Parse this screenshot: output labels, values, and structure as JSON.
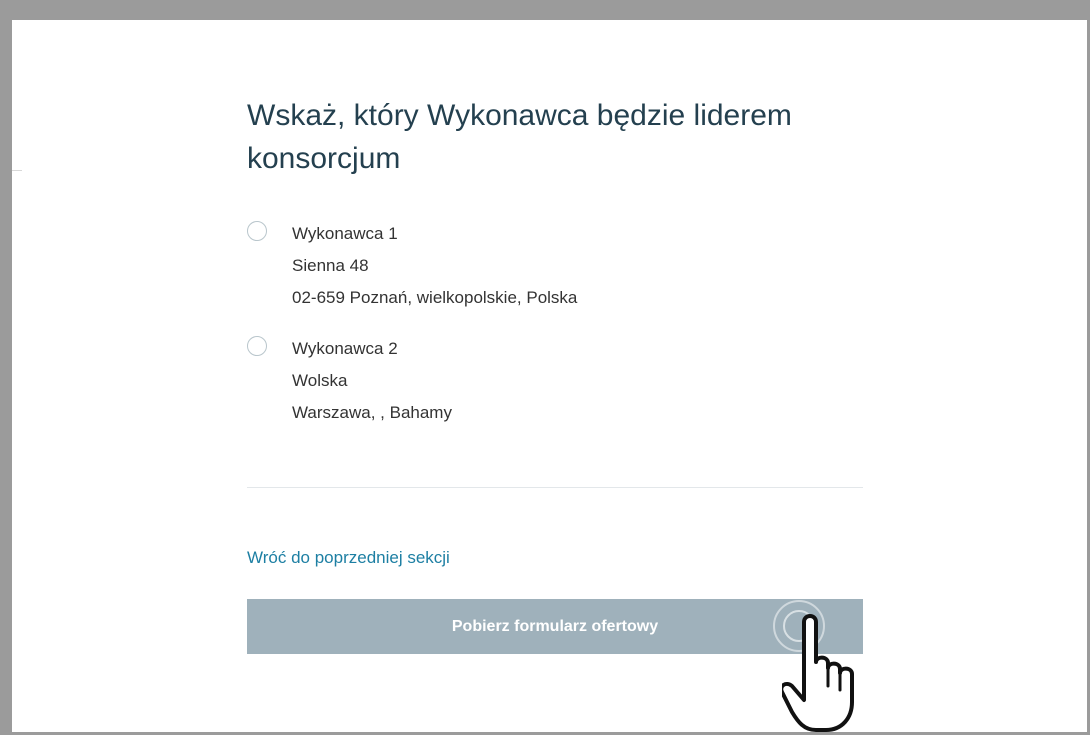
{
  "modal": {
    "title": "Wskaż, który Wykonawca będzie liderem konsorcjum",
    "options": [
      {
        "name": "Wykonawca 1",
        "street": "Sienna 48",
        "city": "02-659 Poznań, wielkopolskie, Polska"
      },
      {
        "name": "Wykonawca 2",
        "street": "Wolska",
        "city": "Warszawa, , Bahamy"
      }
    ],
    "back_link": "Wróć do poprzedniej sekcji",
    "submit_label": "Pobierz formularz ofertowy"
  },
  "colors": {
    "title": "#24404f",
    "link": "#1d7fa3",
    "button_disabled": "#9fb1bb",
    "frame": "#9b9b9b"
  },
  "icons": {
    "cursor": "hand-pointer-icon",
    "radio": "radio-button"
  }
}
